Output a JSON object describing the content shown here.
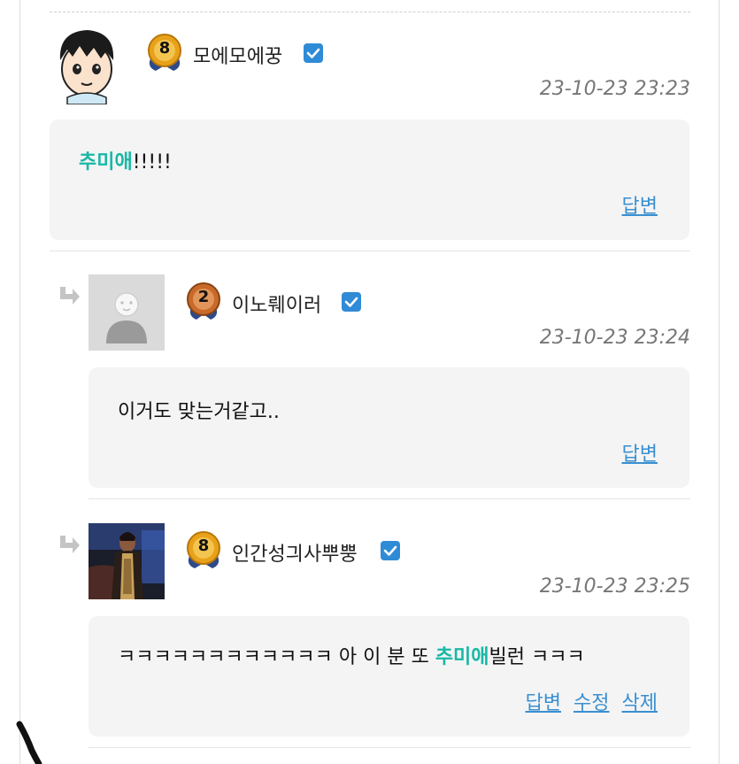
{
  "comments": [
    {
      "nickname": "모에모에꿍",
      "level": "8",
      "timestamp": "23-10-23 23:23",
      "highlight": "추미애",
      "text_before": "",
      "text_after": "!!!!!",
      "actions": [
        "답변"
      ],
      "is_reply": false
    },
    {
      "nickname": "이노뤠이러",
      "level": "2",
      "timestamp": "23-10-23 23:24",
      "highlight": "",
      "text_before": "이거도 맞는거같고..",
      "text_after": "",
      "actions": [
        "답변"
      ],
      "is_reply": true
    },
    {
      "nickname": "인간성긔사뿌뿡",
      "level": "8",
      "timestamp": "23-10-23 23:25",
      "highlight": "추미애",
      "text_before": "ㅋㅋㅋㅋㅋㅋㅋㅋㅋㅋㅋㅋ 아 이 분 또 ",
      "text_after": "빌런 ㅋㅋㅋ",
      "actions": [
        "답변",
        "수정",
        "삭제"
      ],
      "is_reply": true
    }
  ],
  "colors": {
    "highlight": "#18b8a4",
    "link": "#3a8fd0",
    "verified": "#2f8bd6",
    "bubble_bg": "#f4f4f5",
    "gold_badge": "#e8a21a",
    "bronze_badge": "#c86a2a"
  },
  "icons": {
    "verified": "check-icon",
    "reply": "reply-arrow-icon",
    "level": "level-badge-icon"
  }
}
